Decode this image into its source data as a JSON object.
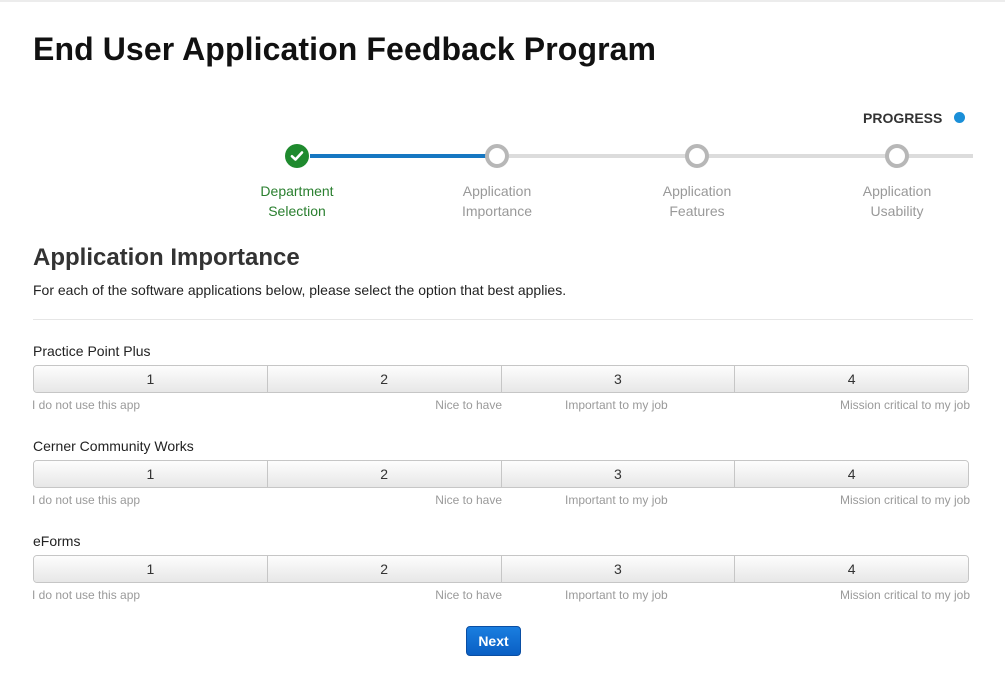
{
  "page_title": "End User Application Feedback Program",
  "progress": {
    "label": "PROGRESS",
    "accent_color": "#1a8fd8",
    "completed_color": "#1f8a2e",
    "steps": [
      {
        "line1": "Department",
        "line2": "Selection",
        "status": "completed",
        "icon": "checkmark-icon"
      },
      {
        "line1": "Application",
        "line2": "Importance",
        "status": "pending",
        "icon": "empty-circle-icon"
      },
      {
        "line1": "Application",
        "line2": "Features",
        "status": "pending",
        "icon": "empty-circle-icon"
      },
      {
        "line1": "Application",
        "line2": "Usability",
        "status": "pending",
        "icon": "empty-circle-icon"
      }
    ]
  },
  "section": {
    "title": "Application Importance",
    "description": "For each of the software applications below, please select the option that best applies."
  },
  "apps": [
    {
      "name": "Practice Point Plus",
      "options": [
        "1",
        "2",
        "3",
        "4"
      ]
    },
    {
      "name": "Cerner Community Works",
      "options": [
        "1",
        "2",
        "3",
        "4"
      ]
    },
    {
      "name": "eForms",
      "options": [
        "1",
        "2",
        "3",
        "4"
      ]
    }
  ],
  "scale_labels": [
    "I do not use this app",
    "Nice to have",
    "Important to my job",
    "Mission critical to my job"
  ],
  "next_label": "Next"
}
